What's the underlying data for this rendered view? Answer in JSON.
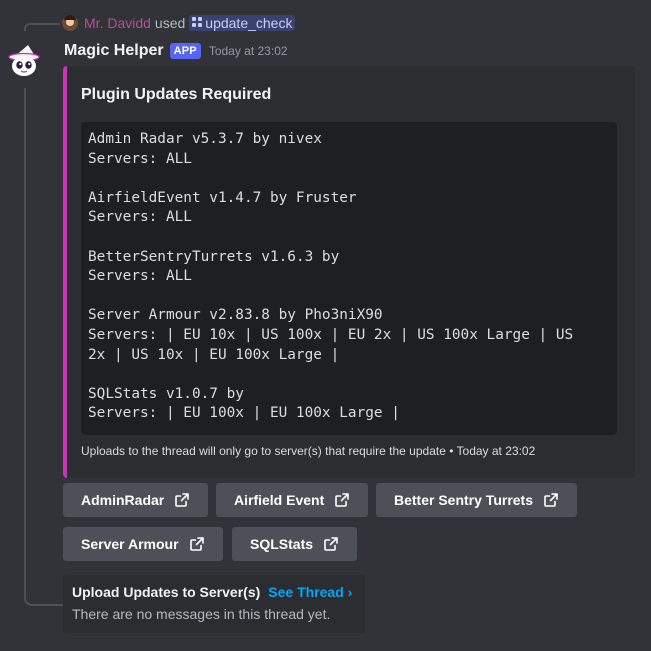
{
  "reply": {
    "username": "Mr. Davidd",
    "used_text": "used",
    "command": "update_check",
    "command_icon": "slash-command-icon"
  },
  "message": {
    "bot_name": "Magic Helper",
    "badge": "APP",
    "timestamp": "Today at 23:02",
    "avatar_icon": "wizard-ghost-avatar"
  },
  "embed": {
    "accent_color": "#c934b8",
    "title": "Plugin Updates Required",
    "code_lines": [
      "Admin Radar v5.3.7 by nivex",
      "Servers: ALL",
      "",
      "AirfieldEvent v1.4.7 by Fruster",
      "Servers: ALL",
      "",
      "BetterSentryTurrets v1.6.3 by",
      "Servers: ALL",
      "",
      "Server Armour v2.83.8 by Pho3niX90",
      "Servers: | EU 10x | US 100x | EU 2x | US 100x Large | US",
      "2x | US 10x | EU 100x Large |",
      "",
      "SQLStats v1.0.7 by",
      "Servers: | EU 100x | EU 100x Large |"
    ],
    "footer": "Uploads to the thread will only go to server(s) that require the update • Today at 23:02"
  },
  "buttons": [
    {
      "label": "AdminRadar",
      "icon": "external-link-icon"
    },
    {
      "label": "Airfield Event",
      "icon": "external-link-icon"
    },
    {
      "label": "Better Sentry Turrets",
      "icon": "external-link-icon"
    },
    {
      "label": "Server Armour",
      "icon": "external-link-icon"
    },
    {
      "label": "SQLStats",
      "icon": "external-link-icon"
    }
  ],
  "thread": {
    "name": "Upload Updates to Server(s)",
    "link": "See Thread ›",
    "empty_text": "There are no messages in this thread yet."
  }
}
